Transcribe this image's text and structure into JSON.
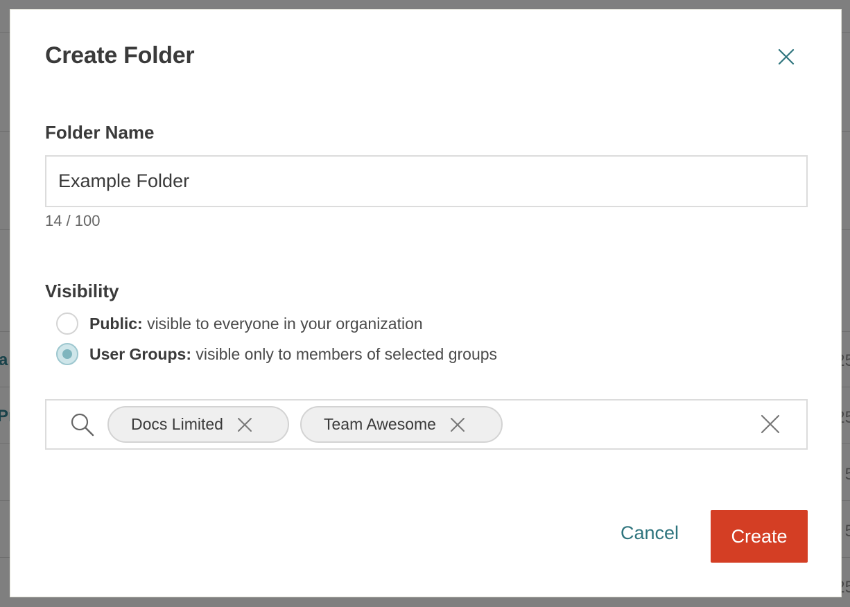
{
  "modal": {
    "title": "Create Folder"
  },
  "folder_name": {
    "label": "Folder Name",
    "value": "Example Folder",
    "count": "14 / 100"
  },
  "visibility": {
    "label": "Visibility",
    "options": [
      {
        "title": "Public:",
        "description": "visible to everyone in your organization",
        "checked": false
      },
      {
        "title": "User Groups:",
        "description": "visible only to members of selected groups",
        "checked": true
      }
    ]
  },
  "groups": {
    "chips": [
      {
        "label": "Docs Limited"
      },
      {
        "label": "Team Awesome"
      }
    ]
  },
  "actions": {
    "cancel_label": "Cancel",
    "create_label": "Create"
  },
  "background": {
    "edge_letters": [
      "a",
      "Pr"
    ],
    "edge_numbers": [
      "25",
      "25",
      "5",
      "5",
      "25"
    ]
  },
  "icons": {
    "close": "close-icon",
    "search": "search-icon",
    "chip_remove": "close-icon",
    "clear": "close-icon"
  },
  "colors": {
    "accent": "#2e747d",
    "primary_button": "#d43e24",
    "radio_selected": "#7fb5be"
  }
}
